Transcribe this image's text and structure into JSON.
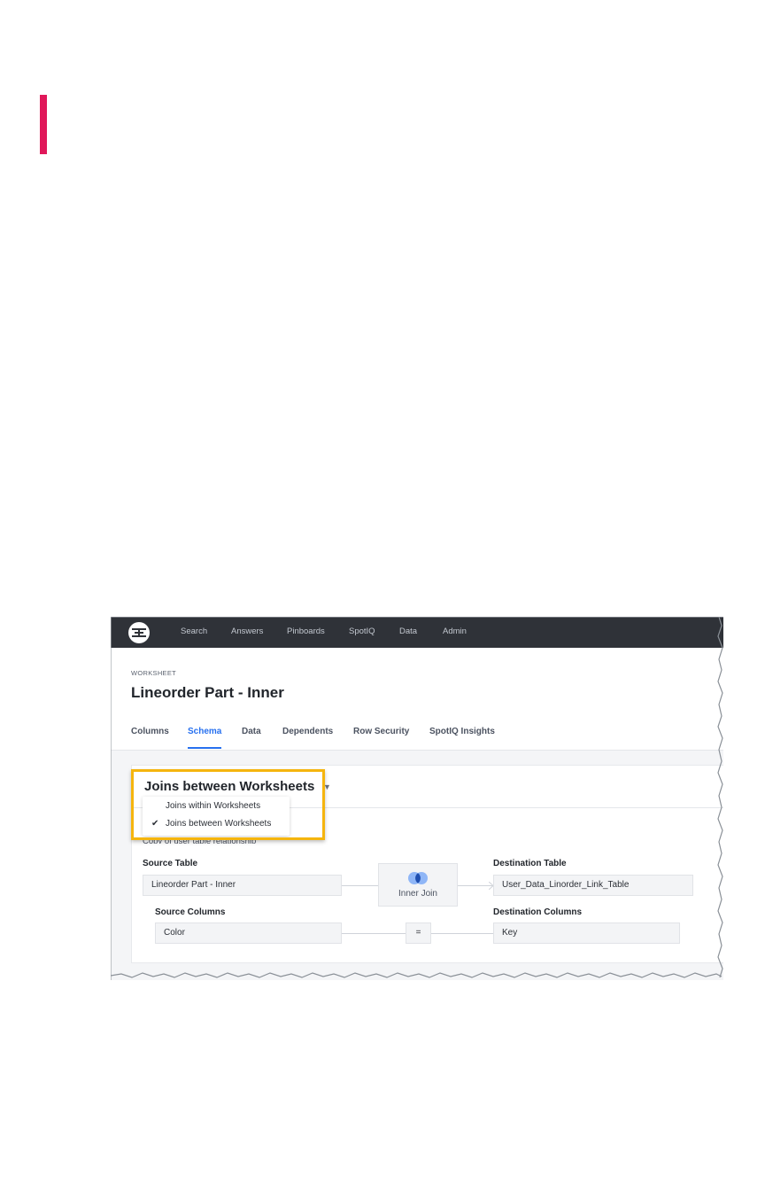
{
  "colors": {
    "accent_bar": "#e0185a",
    "navbar": "#2f3238",
    "active_tab": "#2770ef",
    "highlight_border": "#f5b50e"
  },
  "navbar": {
    "logo_icon": "ts-logo-icon",
    "items": [
      "Search",
      "Answers",
      "Pinboards",
      "SpotIQ",
      "Data",
      "Admin"
    ]
  },
  "header": {
    "kicker": "WORKSHEET",
    "title": "Lineorder Part - Inner"
  },
  "tabs": {
    "items": [
      "Columns",
      "Schema",
      "Data",
      "Dependents",
      "Row Security",
      "SpotIQ Insights"
    ],
    "active": "Schema"
  },
  "joins": {
    "dropdown_selected": "Joins between Worksheets",
    "chevron_icon": "chevron-down-icon",
    "menu_options": [
      "Joins within Worksheets",
      "Joins between Worksheets"
    ],
    "checked_option": "Joins between Worksheets",
    "check_icon": "checkmark-icon",
    "relationship_description": "Copy of user table relationship"
  },
  "relationship": {
    "source_table_label": "Source Table",
    "source_table_value": "Lineorder Part - Inner",
    "join_icon": "inner-join-venn-icon",
    "join_type": "Inner Join",
    "destination_table_label": "Destination Table",
    "destination_table_value": "User_Data_Linorder_Link_Table",
    "source_columns_label": "Source Columns",
    "source_column_value": "Color",
    "operator": "=",
    "destination_columns_label": "Destination Columns",
    "destination_column_value": "Key"
  }
}
